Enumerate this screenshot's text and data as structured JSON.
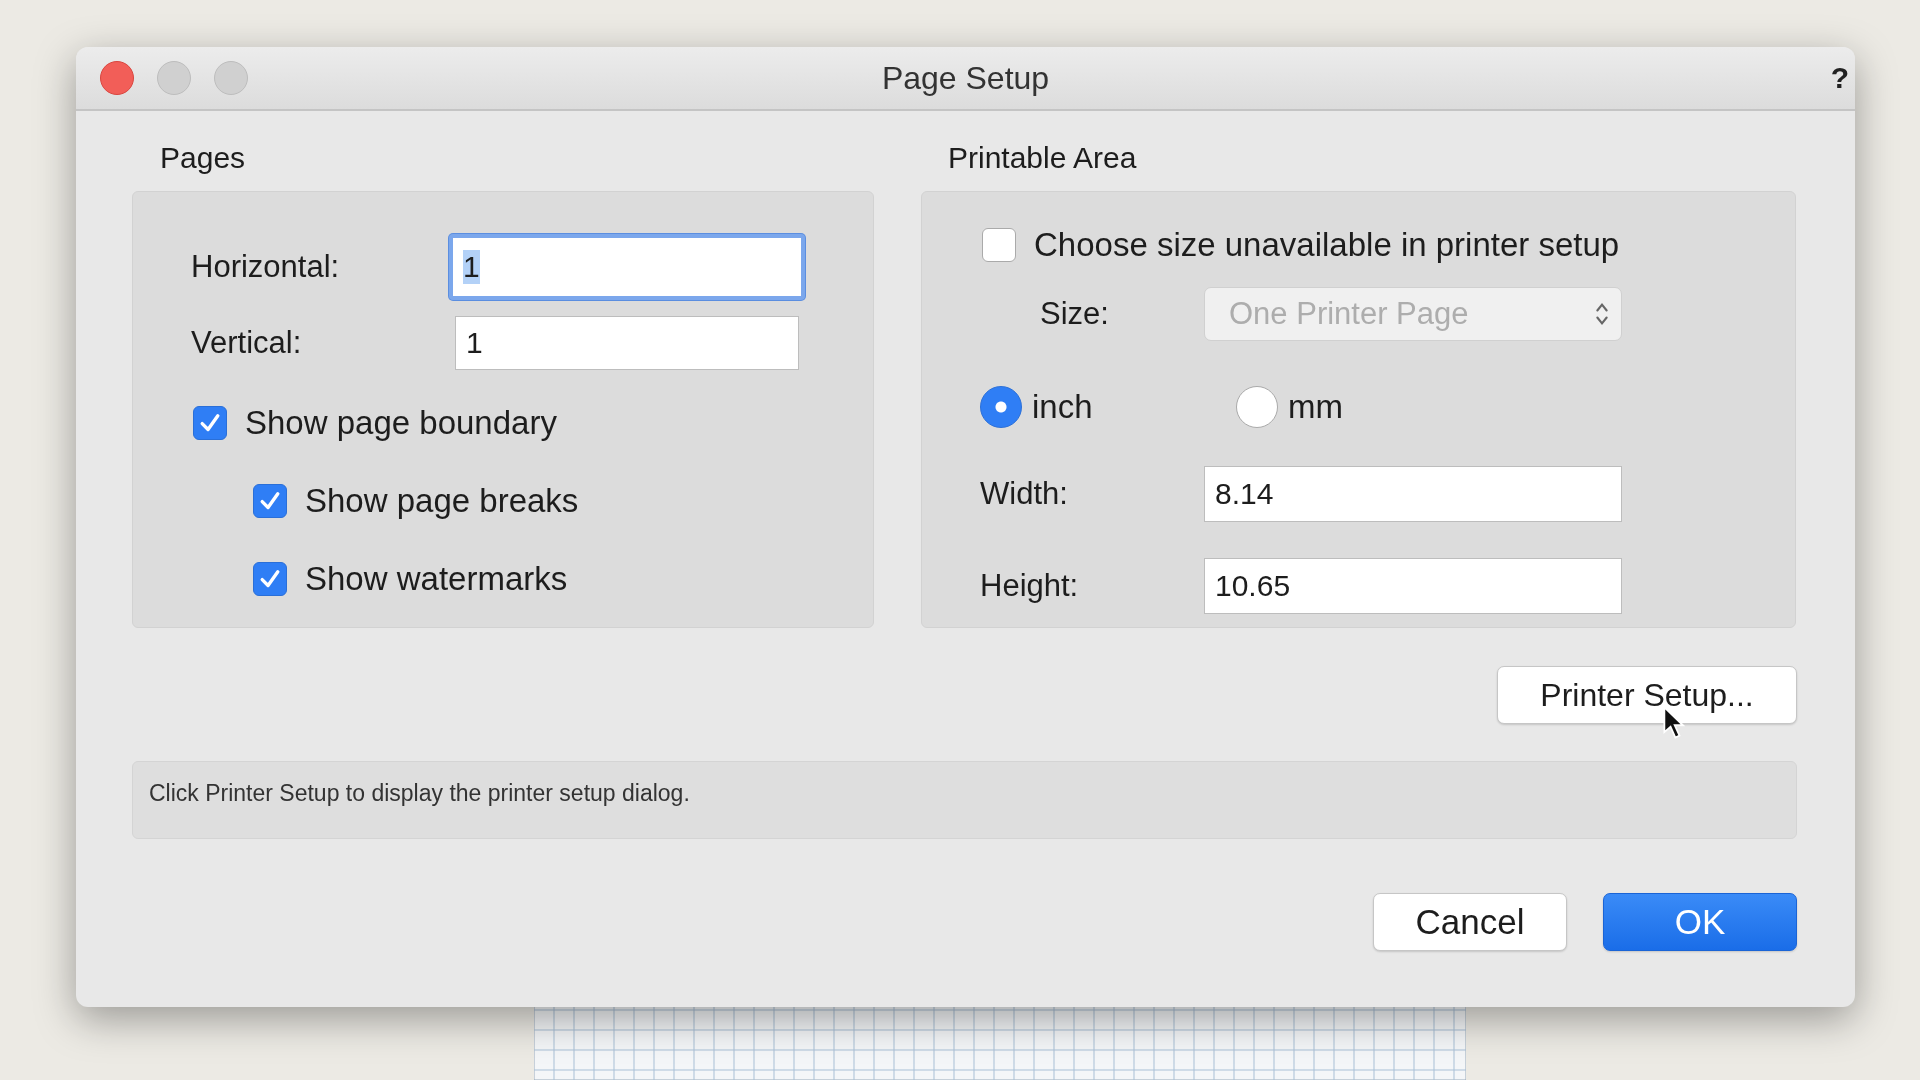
{
  "window": {
    "title": "Page Setup",
    "help": "?"
  },
  "pages": {
    "title": "Pages",
    "fields": [
      {
        "label": "Horizontal:",
        "value": "1",
        "focused": true
      },
      {
        "label": "Vertical:",
        "value": "1",
        "focused": false
      }
    ],
    "checkboxes": [
      {
        "label": "Show page boundary",
        "checked": true,
        "children": [
          {
            "label": "Show page breaks",
            "checked": true
          },
          {
            "label": "Show watermarks",
            "checked": true
          }
        ]
      }
    ]
  },
  "printable_area": {
    "title": "Printable Area",
    "checkbox": {
      "label": "Choose size unavailable in printer setup",
      "checked": false
    },
    "size": {
      "label": "Size:",
      "value": "One Printer Page",
      "disabled": true
    },
    "units": [
      {
        "label": "inch",
        "selected": true
      },
      {
        "label": "mm",
        "selected": false
      }
    ],
    "fields": [
      {
        "label": "Width:",
        "value": "8.14"
      },
      {
        "label": "Height:",
        "value": "10.65"
      }
    ]
  },
  "printer_setup_button": "Printer Setup...",
  "info": "Click Printer Setup to display the printer setup dialog.",
  "buttons": [
    {
      "label": "Cancel",
      "default": false
    },
    {
      "label": "OK",
      "default": true
    }
  ]
}
